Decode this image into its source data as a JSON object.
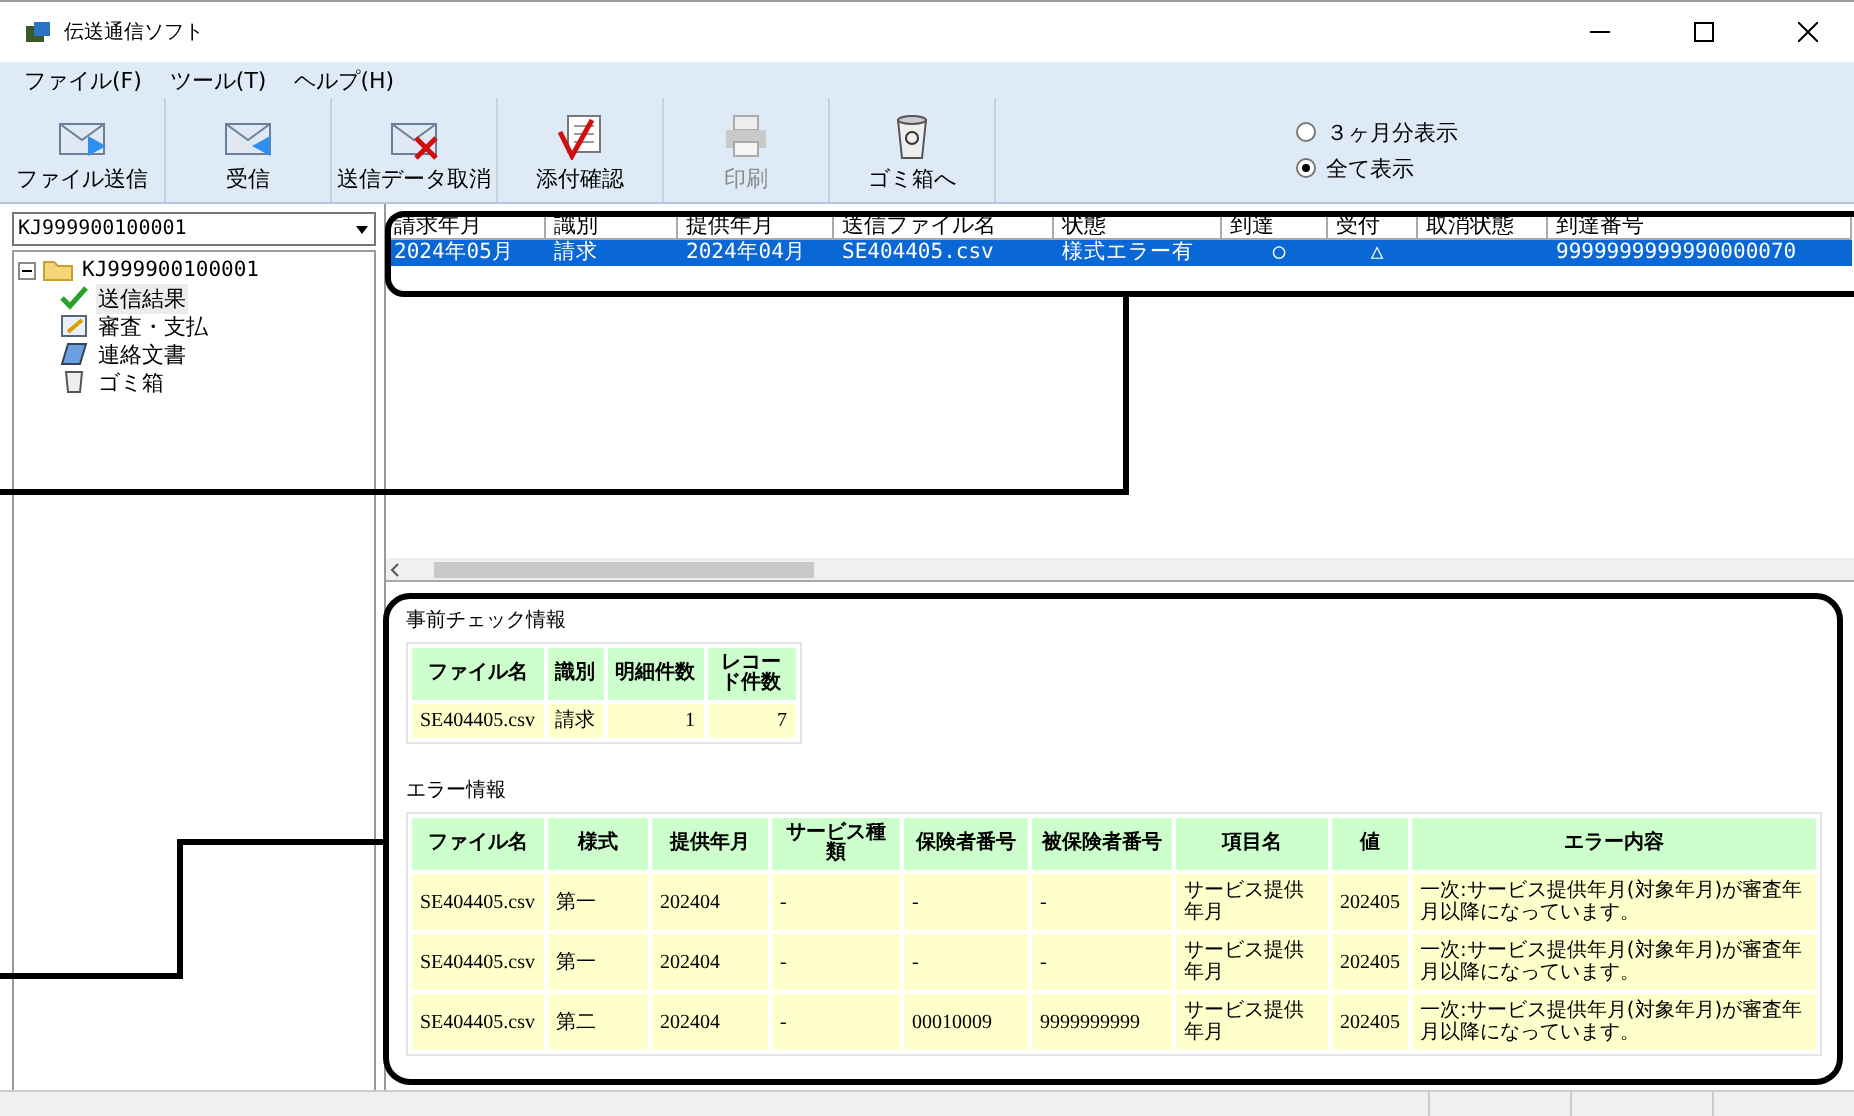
{
  "window": {
    "title": "伝送通信ソフト"
  },
  "menu": [
    {
      "label": "ファイル(F)"
    },
    {
      "label": "ツール(T)"
    },
    {
      "label": "ヘルプ(H)"
    }
  ],
  "toolbar": [
    {
      "kind": "send",
      "label": "ファイル送信",
      "disabled": false
    },
    {
      "kind": "receive",
      "label": "受信",
      "disabled": false
    },
    {
      "kind": "cancel",
      "label": "送信データ取消",
      "disabled": false
    },
    {
      "kind": "confirm",
      "label": "添付確認",
      "disabled": false
    },
    {
      "kind": "print",
      "label": "印刷",
      "disabled": true
    },
    {
      "kind": "trash",
      "label": "ゴミ箱へ",
      "disabled": false
    }
  ],
  "view_options": [
    {
      "label": "３ヶ月分表示",
      "selected": false
    },
    {
      "label": "全て表示",
      "selected": true
    }
  ],
  "account_select": {
    "value": "KJ999900100001"
  },
  "tree": {
    "label": "KJ999900100001",
    "expanded": true,
    "children": [
      {
        "kind": "check",
        "label": "送信結果",
        "selected": true
      },
      {
        "kind": "review",
        "label": "審査・支払",
        "selected": false
      },
      {
        "kind": "notebook",
        "label": "連絡文書",
        "selected": false
      },
      {
        "kind": "trash",
        "label": "ゴミ箱",
        "selected": false
      }
    ]
  },
  "list": {
    "columns": [
      "請求年月",
      "識別",
      "提供年月",
      "送信ファイル名",
      "状態",
      "到達",
      "受付",
      "取消状態",
      "到達番号"
    ],
    "rows": [
      {
        "selected": true,
        "cells": [
          "2024年05月",
          "請求",
          "2024年04月",
          "SE404405.csv",
          "様式エラー有",
          "○",
          "△",
          "",
          "9999999999990000070"
        ]
      }
    ]
  },
  "precheck": {
    "title": "事前チェック情報",
    "columns": [
      "ファイル名",
      "識別",
      "明細件数",
      "レコード件数"
    ],
    "rows": [
      [
        "SE404405.csv",
        "請求",
        "1",
        "7"
      ]
    ]
  },
  "errors": {
    "title": "エラー情報",
    "columns": [
      "ファイル名",
      "様式",
      "提供年月",
      "サービス種類",
      "保険者番号",
      "被保険者番号",
      "項目名",
      "値",
      "エラー内容"
    ],
    "rows": [
      [
        "SE404405.csv",
        "第一",
        "202404",
        "-",
        "-",
        "-",
        "サービス提供年月",
        "202405",
        "一次:サービス提供年月(対象年月)が審査年月以降になっています。"
      ],
      [
        "SE404405.csv",
        "第一",
        "202404",
        "-",
        "-",
        "-",
        "サービス提供年月",
        "202405",
        "一次:サービス提供年月(対象年月)が審査年月以降になっています。"
      ],
      [
        "SE404405.csv",
        "第二",
        "202404",
        "-",
        "00010009",
        "9999999999",
        "サービス提供年月",
        "202405",
        "一次:サービス提供年月(対象年月)が審査年月以降になっています。"
      ]
    ]
  }
}
